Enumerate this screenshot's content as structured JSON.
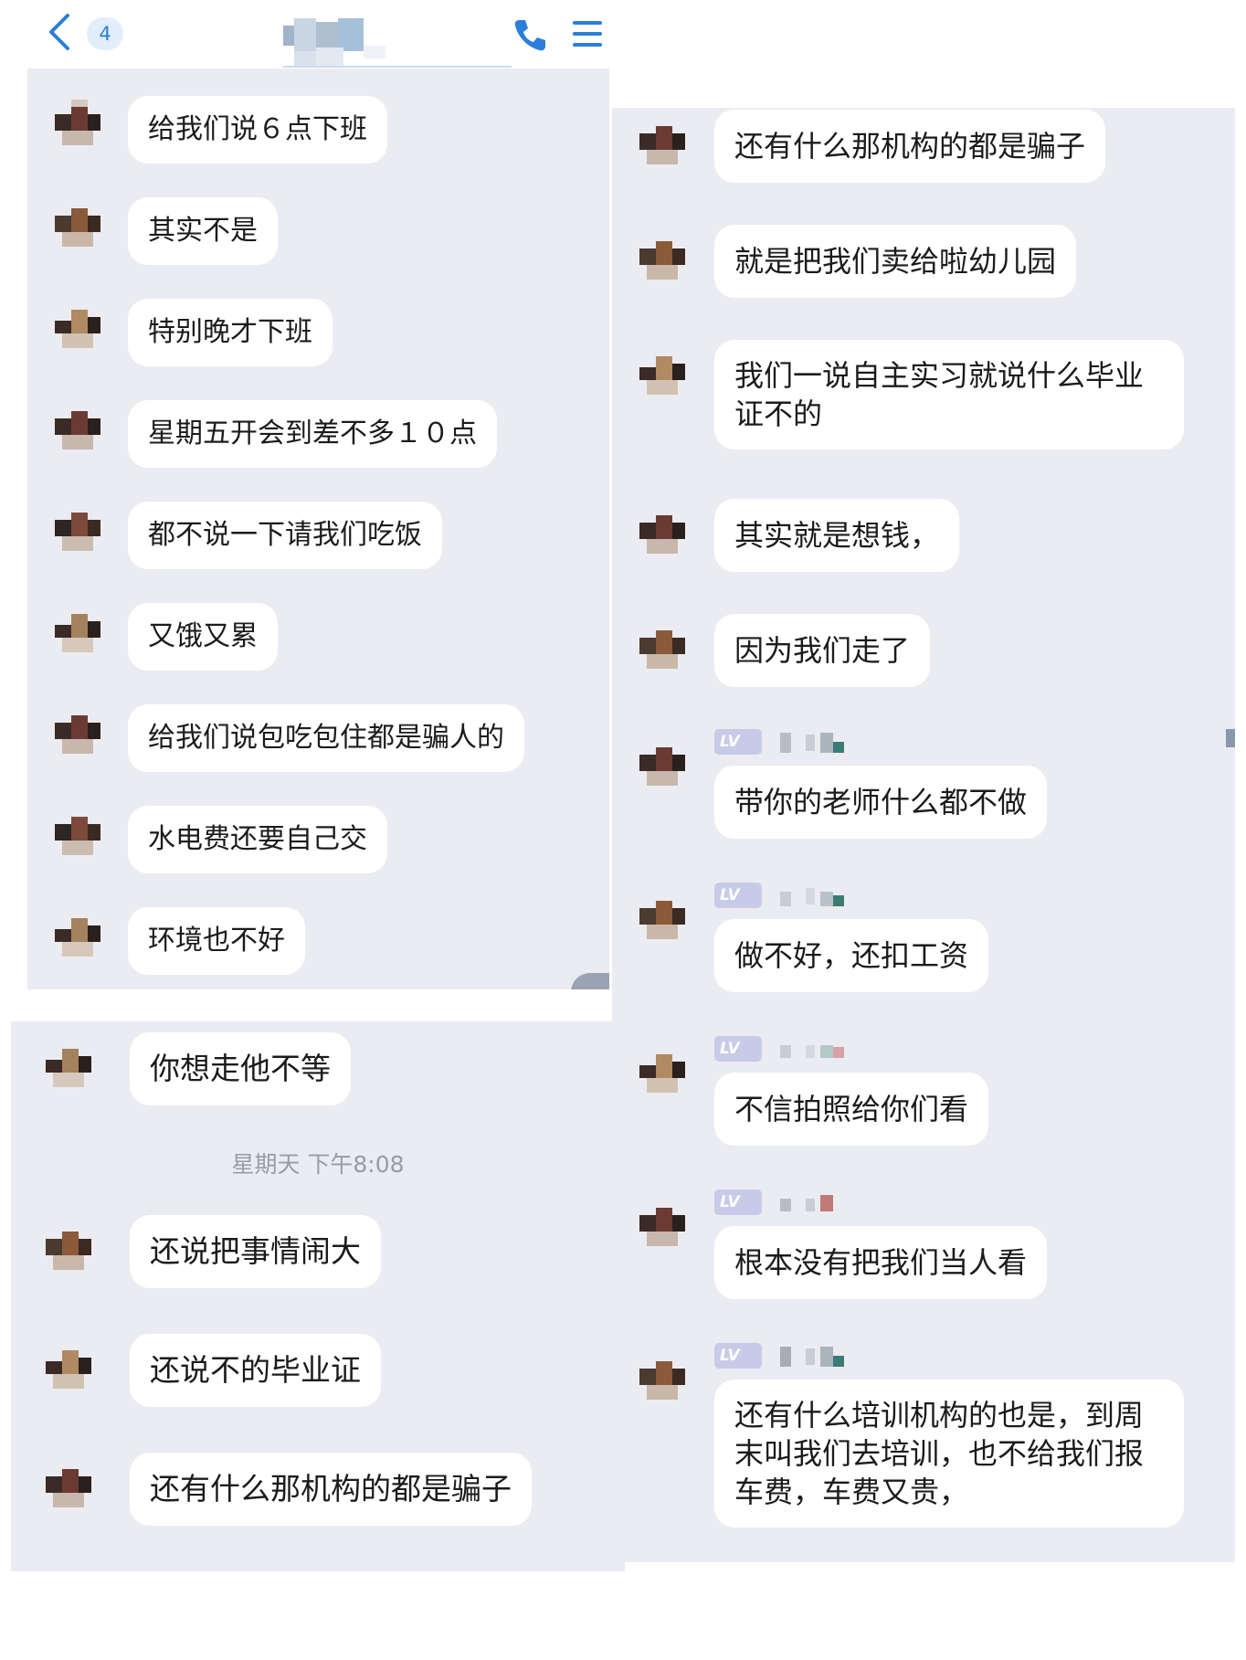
{
  "header": {
    "unread_count": "4",
    "icons": [
      "chevron-left-icon",
      "phone-icon",
      "menu-icon"
    ]
  },
  "panel_a": {
    "messages": [
      {
        "text": "给我们说６点下班"
      },
      {
        "text": "其实不是"
      },
      {
        "text": "特别晚才下班"
      },
      {
        "text": "星期五开会到差不多１０点"
      },
      {
        "text": "都不说一下请我们吃饭"
      },
      {
        "text": "又饿又累"
      },
      {
        "text": "给我们说包吃包住都是骗人的"
      },
      {
        "text": "水电费还要自己交"
      },
      {
        "text": "环境也不好"
      }
    ]
  },
  "panel_b": {
    "messages": [
      {
        "text": "你想走他不等"
      },
      {
        "text": "还说把事情闹大"
      },
      {
        "text": "还说不的毕业证"
      },
      {
        "text": "还有什么那机构的都是骗子"
      }
    ],
    "timestamp": "星期天 下午8:08"
  },
  "panel_c": {
    "messages": [
      {
        "text": "还有什么那机构的都是骗子"
      },
      {
        "text": "就是把我们卖给啦幼儿园"
      },
      {
        "text": "我们一说自主实习就说什么毕业证不的"
      },
      {
        "text": "其实就是想钱，"
      },
      {
        "text": "因为我们走了"
      },
      {
        "text": "带你的老师什么都不做",
        "level_tag": "LV"
      },
      {
        "text": "做不好，还扣工资",
        "level_tag": "LV"
      },
      {
        "text": "不信拍照给你们看",
        "level_tag": "LV"
      },
      {
        "text": "根本没有把我们当人看",
        "level_tag": "LV"
      },
      {
        "text": "还有什么培训机构的也是，到周末叫我们去培训，也不给我们报车费，车费又贵，",
        "level_tag": "LV"
      }
    ]
  },
  "colors": {
    "chat_background": "#ebecf1",
    "bubble": "#ffffff",
    "accent": "#2d7ed8",
    "level_tag": "#c7cbe8"
  }
}
